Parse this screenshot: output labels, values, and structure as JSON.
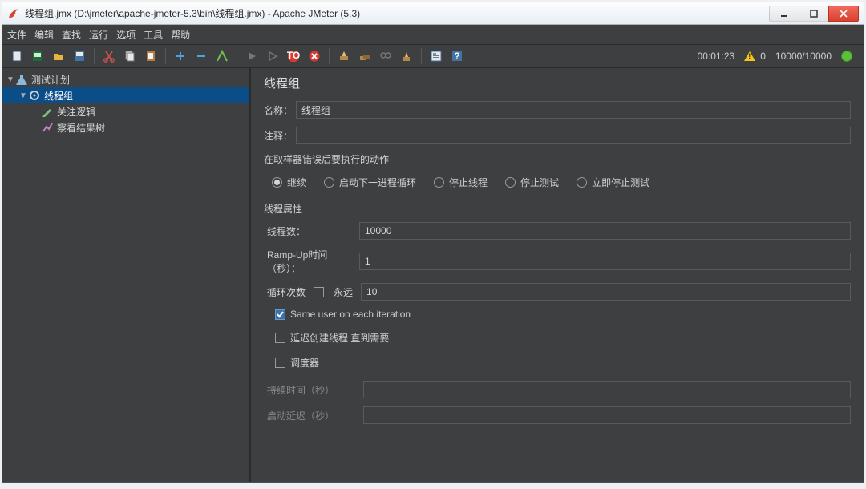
{
  "window": {
    "title": "线程组.jmx (D:\\jmeter\\apache-jmeter-5.3\\bin\\线程组.jmx) - Apache JMeter (5.3)"
  },
  "menu": [
    "文件",
    "编辑",
    "查找",
    "运行",
    "选项",
    "工具",
    "帮助"
  ],
  "toolbar_status": {
    "elapsed": "00:01:23",
    "warn_count": "0",
    "threads": "10000/10000"
  },
  "tree": {
    "root": "测试计划",
    "thread_group": "线程组",
    "children": [
      "关注逻辑",
      "察看结果树"
    ]
  },
  "panel": {
    "title": "线程组",
    "name_label": "名称：",
    "name_value": "线程组",
    "comment_label": "注释：",
    "comment_value": "",
    "error_section": "在取样器错误后要执行的动作",
    "radios": {
      "continue": "继续",
      "start_next": "启动下一进程循环",
      "stop_thread": "停止线程",
      "stop_test": "停止测试",
      "stop_now": "立即停止测试",
      "selected": "continue"
    },
    "thread_props_label": "线程属性",
    "threads_label": "线程数：",
    "threads_value": "10000",
    "rampup_label": "Ramp-Up时间（秒）：",
    "rampup_value": "1",
    "loop_label": "循环次数",
    "loop_forever": "永远",
    "loop_value": "10",
    "same_user": "Same user on each iteration",
    "delay_create": "延迟创建线程 直到需要",
    "scheduler": "调度器",
    "duration_label": "持续时间（秒）",
    "startup_delay_label": "启动延迟（秒）"
  }
}
